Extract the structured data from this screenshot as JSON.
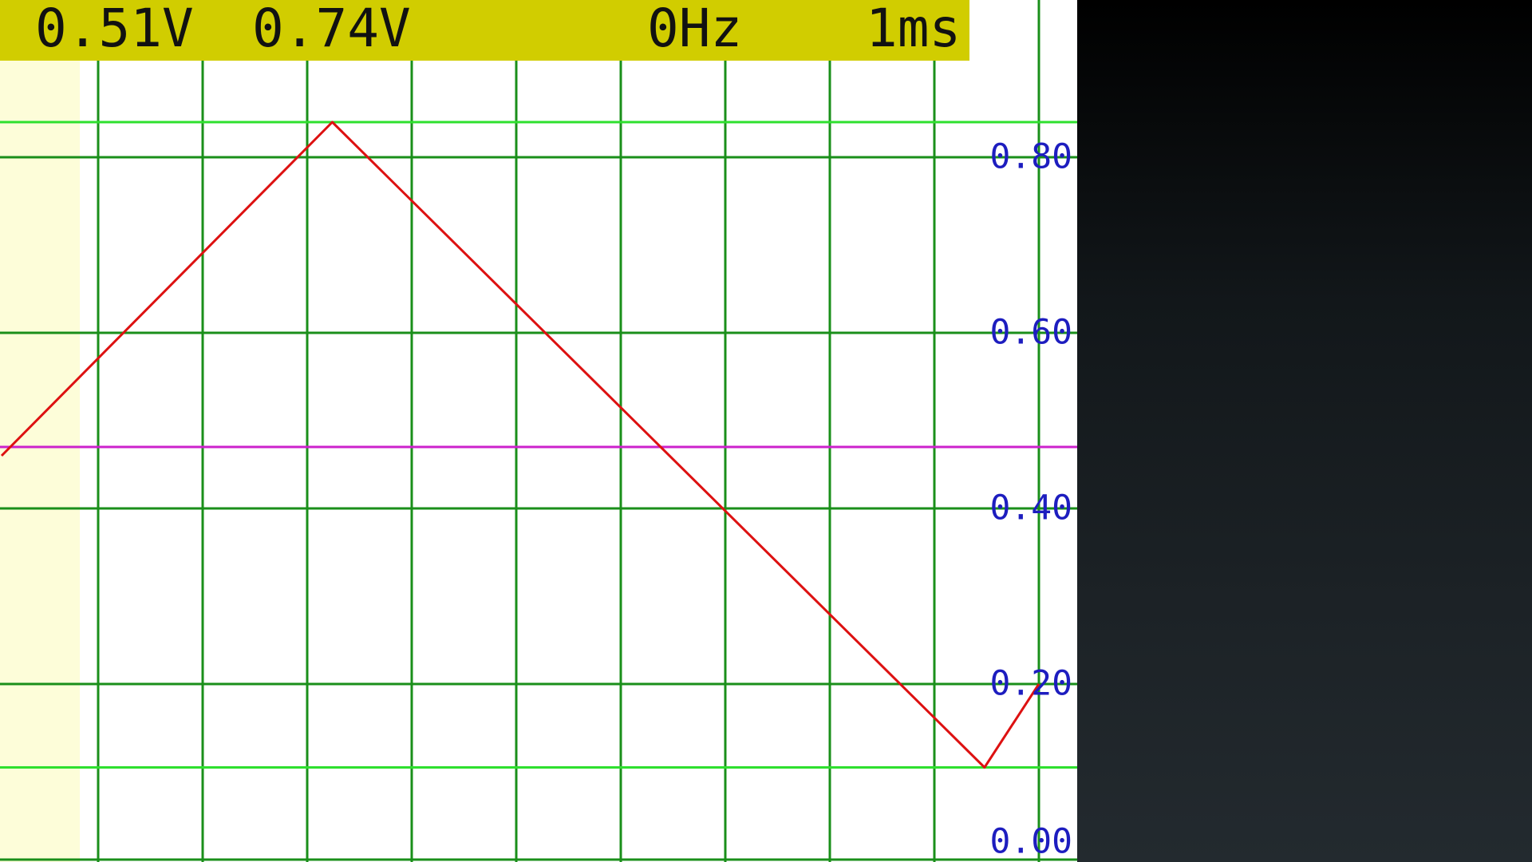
{
  "header": {
    "voltage_1": "0.51V",
    "voltage_2": "0.74V",
    "frequency": "0Hz",
    "timebase": "1ms",
    "background_color": "#d1cd00"
  },
  "colors": {
    "grid": "#1a8f1a",
    "cursor_lines": "#2ee02e",
    "trigger_level": "#cc22cc",
    "trace": "#dd1111",
    "pre_trigger_shade": "#fdfdd9",
    "axis_label": "#1d1dbf"
  },
  "y_axis": {
    "labels": [
      "0.80",
      "0.60",
      "0.40",
      "0.20",
      "0.00"
    ],
    "values": [
      0.8,
      0.6,
      0.4,
      0.2,
      0.0
    ],
    "range": [
      0.0,
      0.8
    ]
  },
  "cursors": {
    "upper_volts": 0.84,
    "lower_volts": 0.105
  },
  "trigger_level_volts": 0.47,
  "chart_data": {
    "type": "line",
    "title": "",
    "xlabel": "",
    "ylabel": "",
    "ylim": [
      0.0,
      0.8
    ],
    "grid": true,
    "x_divisions": 10,
    "series": [
      {
        "x": [
          0.0,
          3.24,
          9.48,
          10.0
        ],
        "values": [
          0.46,
          0.84,
          0.105,
          0.2
        ]
      }
    ]
  }
}
